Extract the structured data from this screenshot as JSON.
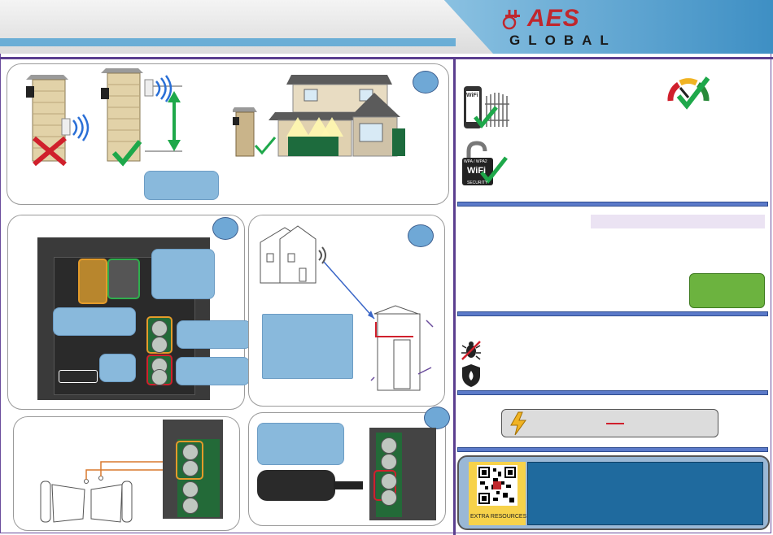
{
  "header": {
    "logo_brand": "AES",
    "logo_sub": "GLOBAL"
  },
  "sidebar": {
    "security_badge_line1": "WPA / WPA2",
    "security_badge_line2": "WiFi",
    "security_badge_line3": "SECURITY",
    "phone_label": "WiFi"
  },
  "resources": {
    "qr_label": "EXTRA RESOURCES"
  },
  "colors": {
    "accent_purple": "#5b3f8f",
    "callout_blue": "#89b9dc",
    "check_green": "#1ea84a",
    "cross_red": "#d0202c",
    "panel_blue": "#1f6a9e"
  }
}
